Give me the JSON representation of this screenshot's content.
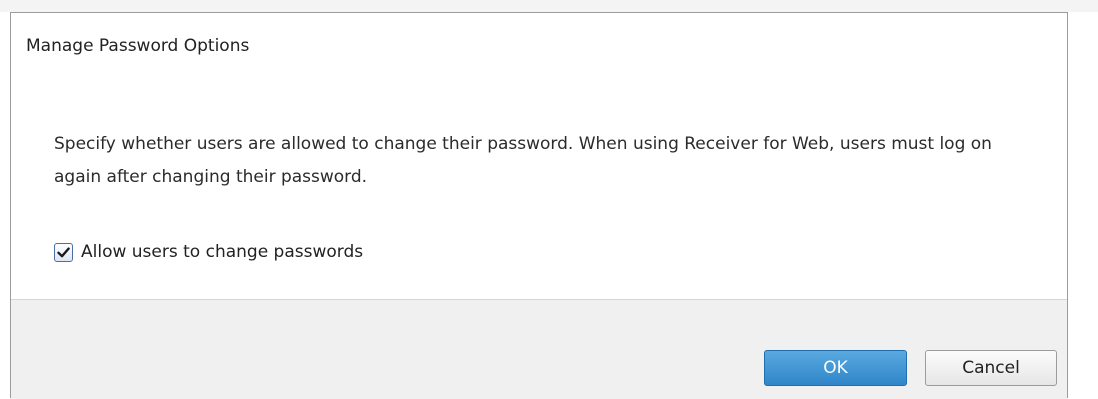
{
  "dialog": {
    "title": "Manage Password Options",
    "description": "Specify whether users are allowed to change their password. When using Receiver for Web, users must log on again after changing their password.",
    "checkbox": {
      "label": "Allow users to change passwords",
      "checked": true
    },
    "buttons": {
      "ok_label": "OK",
      "cancel_label": "Cancel"
    }
  },
  "colors": {
    "primary_button": "#2f86c8",
    "footer_background": "#f0f0f0"
  }
}
